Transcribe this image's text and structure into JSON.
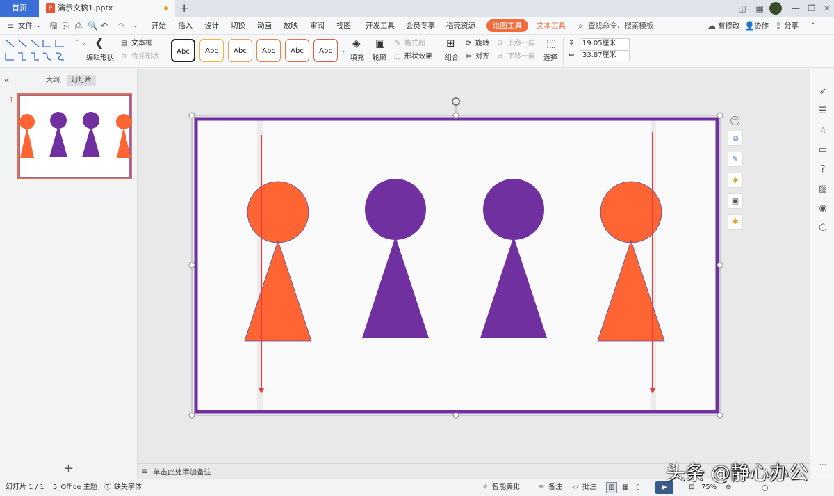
{
  "tabbar": {
    "home": "首页",
    "doc_title": "演示文稿1.pptx",
    "new_tab": "+",
    "doc_icon": "P"
  },
  "menu": {
    "file": "文件",
    "items": [
      "开始",
      "插入",
      "设计",
      "切换",
      "动画",
      "放映",
      "审阅",
      "视图",
      "开发工具",
      "会员专享",
      "稻壳资源"
    ],
    "drawing_tools": "绘图工具",
    "text_tools": "文本工具",
    "search": "查找命令、搜索模板",
    "has_changes": "有修改",
    "collab": "协作",
    "share": "分享"
  },
  "ribbon": {
    "edit_shape": "编辑形状",
    "text_box": "文本框",
    "merge_shape": "合并形状",
    "style_samples": [
      "Abc",
      "Abc",
      "Abc",
      "Abc",
      "Abc",
      "Abc"
    ],
    "style_colors": [
      "#222222",
      "#f0b53a",
      "#f0a05a",
      "#e8804a",
      "#e8704a",
      "#e05a4a"
    ],
    "fill": "填充",
    "outline": "轮廓",
    "format_brush": "格式刷",
    "shape_effect": "形状效果",
    "group": "组合",
    "rotate": "旋转",
    "align": "对齐",
    "bring_forward": "上移一层",
    "send_backward": "下移一层",
    "select": "选择",
    "height": "19.05厘米",
    "width": "33.87厘米"
  },
  "panel": {
    "outline_tab": "大纲",
    "slides_tab": "幻灯片",
    "slide_number": "1",
    "add": "+"
  },
  "slide": {
    "frame_color": "#6a2e9c",
    "orange": "#ff6433",
    "purple": "#7030a0",
    "arrow_color": "#e83a3a"
  },
  "notes": {
    "placeholder": "单击此处添加备注"
  },
  "status": {
    "slide_info": "幻灯片 1 / 1",
    "theme": "5_Office 主题",
    "missing_font": "缺失字体",
    "smart": "智能美化",
    "notes": "备注",
    "comments": "批注",
    "zoom": "75%"
  },
  "watermark": "头条 @静心办公"
}
